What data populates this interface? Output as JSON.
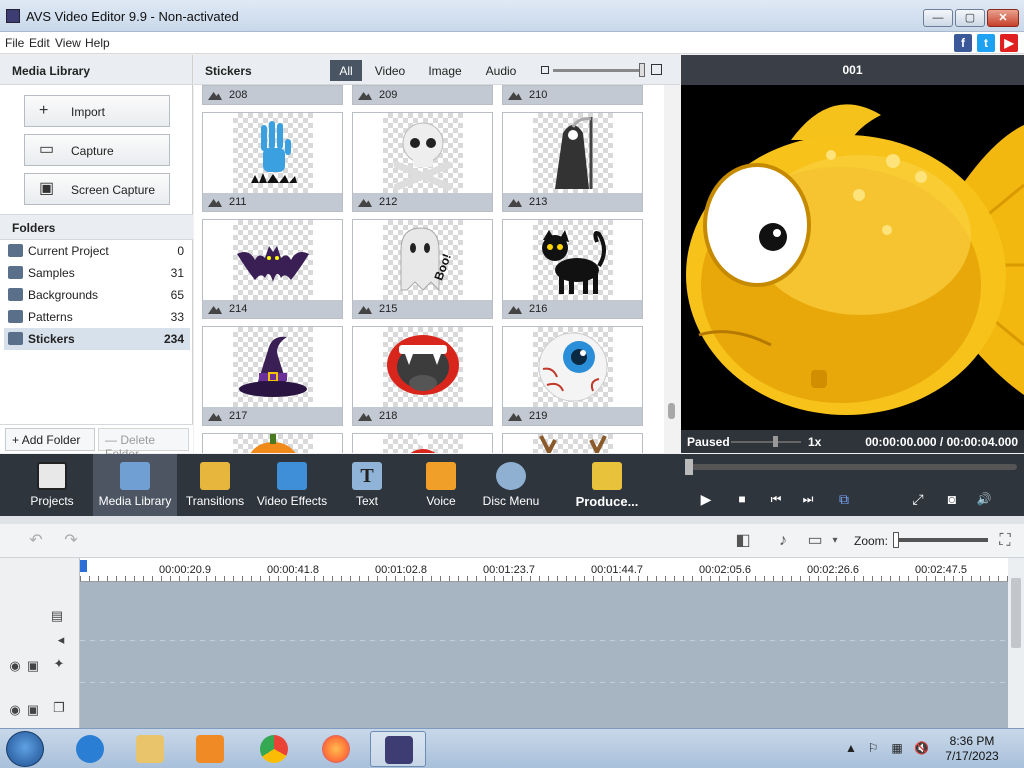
{
  "window": {
    "title": "AVS Video Editor 9.9 - Non-activated",
    "min_glyph": "—",
    "max_glyph": "▢",
    "close_glyph": "✕"
  },
  "menu": [
    "File",
    "Edit",
    "View",
    "Help"
  ],
  "social": [
    {
      "name": "facebook-icon",
      "glyph": "f",
      "color": "#3b5998"
    },
    {
      "name": "twitter-icon",
      "glyph": "t",
      "color": "#1da1f2"
    },
    {
      "name": "youtube-icon",
      "glyph": "▶",
      "color": "#e02020"
    }
  ],
  "media_library": {
    "title": "Media Library",
    "buttons": [
      {
        "name": "import-button",
        "label": "Import",
        "icon": "plus-icon",
        "glyph": "+"
      },
      {
        "name": "capture-button",
        "label": "Capture",
        "icon": "camera-icon",
        "glyph": "▭"
      },
      {
        "name": "screen-capture-button",
        "label": "Screen Capture",
        "icon": "screen-capture-icon",
        "glyph": "▣"
      }
    ],
    "folders_title": "Folders",
    "folders": [
      {
        "label": "Current Project",
        "count": "0",
        "selected": false
      },
      {
        "label": "Samples",
        "count": "31",
        "selected": false
      },
      {
        "label": "Backgrounds",
        "count": "65",
        "selected": false
      },
      {
        "label": "Patterns",
        "count": "33",
        "selected": false
      },
      {
        "label": "Stickers",
        "count": "234",
        "selected": true
      }
    ],
    "add_folder": "Add Folder",
    "delete_folder": "Delete Folder"
  },
  "stickers": {
    "title": "Stickers",
    "filters": [
      {
        "label": "All",
        "active": true
      },
      {
        "label": "Video",
        "active": false
      },
      {
        "label": "Image",
        "active": false
      },
      {
        "label": "Audio",
        "active": false
      }
    ],
    "top_row": [
      "208",
      "209",
      "210"
    ],
    "items": [
      {
        "label": "211",
        "icon": "zombie-hand-sticker"
      },
      {
        "label": "212",
        "icon": "skull-crossbones-sticker"
      },
      {
        "label": "213",
        "icon": "grim-reaper-sticker"
      },
      {
        "label": "214",
        "icon": "bat-sticker"
      },
      {
        "label": "215",
        "icon": "ghost-boo-sticker",
        "text": "Boo!"
      },
      {
        "label": "216",
        "icon": "black-cat-sticker"
      },
      {
        "label": "217",
        "icon": "witch-hat-sticker"
      },
      {
        "label": "218",
        "icon": "vampire-mouth-sticker"
      },
      {
        "label": "219",
        "icon": "eyeball-sticker"
      }
    ]
  },
  "preview": {
    "header": "001",
    "status": "Paused",
    "rate": "1x",
    "time": "00:00:00.000 / 00:00:04.000"
  },
  "toolbar": [
    {
      "name": "projects-tool",
      "label": "Projects",
      "icon": "clapperboard-icon",
      "color": "#e8e8e8",
      "active": false
    },
    {
      "name": "media-library-tool",
      "label": "Media Library",
      "icon": "film-strip-icon",
      "color": "#6f9fd3",
      "active": true
    },
    {
      "name": "transitions-tool",
      "label": "Transitions",
      "icon": "transitions-icon",
      "color": "#e6b63d",
      "active": false
    },
    {
      "name": "video-effects-tool",
      "label": "Video Effects",
      "icon": "star-icon",
      "color": "#3f8fd8",
      "active": false
    },
    {
      "name": "text-tool",
      "label": "Text",
      "icon": "text-icon",
      "color": "#8fb4d8",
      "active": false
    },
    {
      "name": "voice-tool",
      "label": "Voice",
      "icon": "microphone-icon",
      "color": "#f0a028",
      "active": false
    },
    {
      "name": "disc-menu-tool",
      "label": "Disc Menu",
      "icon": "disc-icon",
      "color": "#8fb0d0",
      "active": false
    },
    {
      "name": "produce-tool",
      "label": "Produce...",
      "icon": "produce-icon",
      "color": "#e8c23a",
      "active": false
    }
  ],
  "player_controls": [
    {
      "name": "play-icon",
      "glyph": "▶"
    },
    {
      "name": "stop-icon",
      "glyph": "■"
    },
    {
      "name": "previous-frame-icon",
      "glyph": "⏮"
    },
    {
      "name": "next-frame-icon",
      "glyph": "⏭"
    },
    {
      "name": "split-screen-icon",
      "glyph": "⧉"
    },
    {
      "name": "fullscreen-icon",
      "glyph": "⤢"
    },
    {
      "name": "snapshot-icon",
      "glyph": "◙"
    },
    {
      "name": "volume-icon",
      "glyph": "🔊"
    }
  ],
  "timeline_controls": {
    "zoom_label": "Zoom:"
  },
  "ruler": [
    "00:00:20.9",
    "00:00:41.8",
    "00:01:02.8",
    "00:01:23.7",
    "00:01:44.7",
    "00:02:05.6",
    "00:02:26.6",
    "00:02:47.5"
  ],
  "clock": {
    "time": "8:36 PM",
    "date": "7/17/2023"
  },
  "taskbar_apps": [
    {
      "name": "internet-explorer-icon",
      "color": "#2a7fd4",
      "active": false
    },
    {
      "name": "file-explorer-icon",
      "color": "#e9c46a",
      "active": false
    },
    {
      "name": "media-player-icon",
      "color": "#f08a24",
      "active": false
    },
    {
      "name": "chrome-icon",
      "color": "#34a853",
      "active": false
    },
    {
      "name": "firefox-icon",
      "color": "#ff7139",
      "active": false
    },
    {
      "name": "avs-video-editor-icon",
      "color": "#3d3d73",
      "active": true
    }
  ],
  "tray": [
    "▲",
    "⚐",
    "▦",
    "🔇"
  ]
}
